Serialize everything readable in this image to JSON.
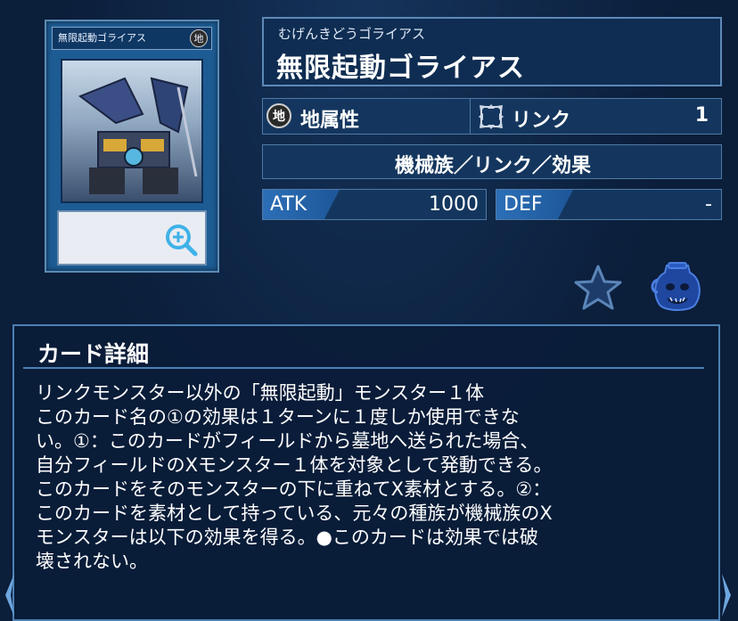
{
  "card_image": {
    "name": "無限起動ゴライアス",
    "attribute_glyph": "地"
  },
  "card": {
    "reading": "むげんきどうゴライアス",
    "name": "無限起動ゴライアス",
    "attribute_icon_text": "地",
    "attribute": "地属性",
    "link_label": "リンク",
    "link_value": "1",
    "type_line": "機械族／リンク／効果",
    "atk_label": "ATK",
    "atk_value": "1000",
    "def_label": "DEF",
    "def_value": "-"
  },
  "detail": {
    "title": "カード詳細",
    "text": "リンクモンスター以外の「無限起動」モンスター１体\nこのカード名の①の効果は１ターンに１度しか使用できな\nい。①：このカードがフィールドから墓地へ送られた場合、\n自分フィールドのXモンスター１体を対象として発動できる。\nこのカードをそのモンスターの下に重ねてX素材とする。②：\nこのカードを素材として持っている、元々の種族が機械族のX\nモンスターは以下の効果を得る。●このカードは効果では破\n壊されない。"
  },
  "icons": [
    "zoom-icon",
    "favorite-star-icon",
    "deck-pot-icon",
    "link-arrow-icon"
  ],
  "colors": {
    "background": "#0b1e3a",
    "panel": "#14365e",
    "border": "#4f7aa6",
    "stat_tag": "#2c6fb7",
    "card_blue": "#1d5b93"
  }
}
